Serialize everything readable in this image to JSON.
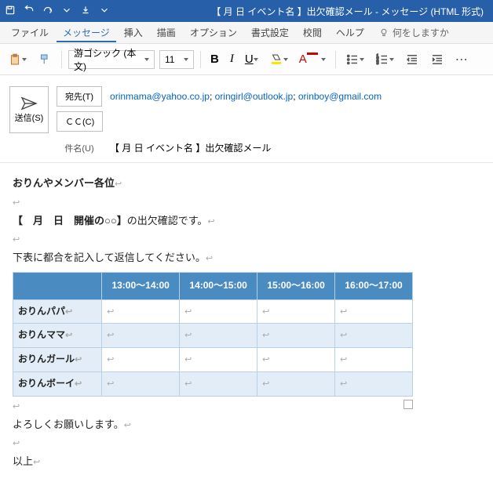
{
  "titlebar": {
    "title": "【 月  日 イベント名 】出欠確認メール  -  メッセージ (HTML 形式)"
  },
  "menus": {
    "file": "ファイル",
    "message": "メッセージ",
    "insert": "挿入",
    "draw": "描画",
    "options": "オプション",
    "format": "書式設定",
    "review": "校閲",
    "help": "ヘルプ",
    "tellme": "何をしますか"
  },
  "toolbar": {
    "font_name": "游ゴシック (本文)",
    "font_size": "11"
  },
  "send": {
    "label": "送信(S)"
  },
  "fields": {
    "to_label": "宛先(T)",
    "to_value_1": "orinmama@yahoo.co.jp",
    "to_value_2": "oringirl@outlook.jp",
    "to_value_3": "orinboy@gmail.com",
    "cc_label": "ＣＣ(C)",
    "subject_label": "件名(U)",
    "subject_value": "【 月  日 イベント名 】出欠確認メール"
  },
  "body": {
    "greeting": "おりんやメンバー各位",
    "line1a": "【　月　日　開催の○○】",
    "line1b": "の出欠確認です。",
    "line2": "下表に都合を記入して返信してください。",
    "closing1": "よろしくお願いします。",
    "closing2": "以上"
  },
  "table": {
    "h1": "13:00～14:00",
    "h2": "14:00～15:00",
    "h3": "15:00～16:00",
    "h4": "16:00～17:00",
    "r1": "おりんパパ",
    "r2": "おりんママ",
    "r3": "おりんガール",
    "r4": "おりんボーイ"
  }
}
